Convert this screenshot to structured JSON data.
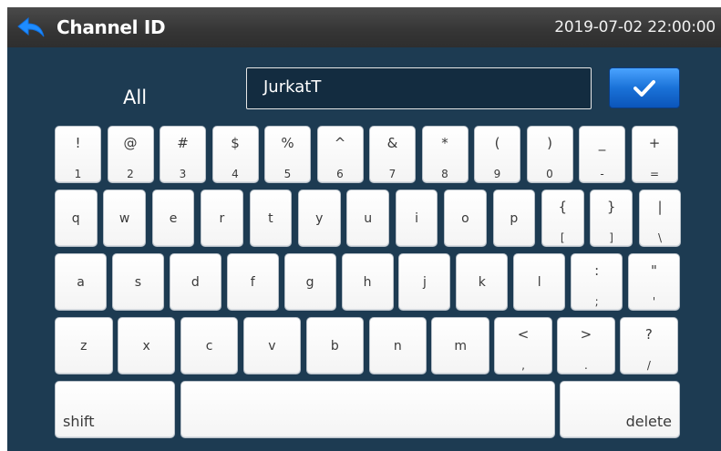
{
  "header": {
    "title": "Channel ID",
    "datetime": "2019-07-02  22:00:00",
    "back_icon": "back-arrow-icon"
  },
  "mode_label": "All",
  "input": {
    "value": "JurkatT"
  },
  "confirm_icon": "checkmark-icon",
  "colors": {
    "background": "#1d3b52",
    "header": "#3a3a3a",
    "accent": "#1a72d8",
    "key": "#ffffff"
  },
  "keyboard": {
    "row1": [
      {
        "upper": "!",
        "lower": "1"
      },
      {
        "upper": "@",
        "lower": "2"
      },
      {
        "upper": "#",
        "lower": "3"
      },
      {
        "upper": "$",
        "lower": "4"
      },
      {
        "upper": "%",
        "lower": "5"
      },
      {
        "upper": "^",
        "lower": "6"
      },
      {
        "upper": "&",
        "lower": "7"
      },
      {
        "upper": "*",
        "lower": "8"
      },
      {
        "upper": "(",
        "lower": "9"
      },
      {
        "upper": ")",
        "lower": "0"
      },
      {
        "upper": "_",
        "lower": "-"
      },
      {
        "upper": "+",
        "lower": "="
      }
    ],
    "row2": [
      {
        "label": "q"
      },
      {
        "label": "w"
      },
      {
        "label": "e"
      },
      {
        "label": "r"
      },
      {
        "label": "t"
      },
      {
        "label": "y"
      },
      {
        "label": "u"
      },
      {
        "label": "i"
      },
      {
        "label": "o"
      },
      {
        "label": "p"
      },
      {
        "upper": "{",
        "lower": "["
      },
      {
        "upper": "}",
        "lower": "]"
      },
      {
        "upper": "|",
        "lower": "\\"
      }
    ],
    "row3": [
      {
        "label": "a"
      },
      {
        "label": "s"
      },
      {
        "label": "d"
      },
      {
        "label": "f"
      },
      {
        "label": "g"
      },
      {
        "label": "h"
      },
      {
        "label": "j"
      },
      {
        "label": "k"
      },
      {
        "label": "l"
      },
      {
        "upper": ":",
        "lower": ";"
      },
      {
        "upper": "\"",
        "lower": "'"
      }
    ],
    "row4": [
      {
        "label": "z"
      },
      {
        "label": "x"
      },
      {
        "label": "c"
      },
      {
        "label": "v"
      },
      {
        "label": "b"
      },
      {
        "label": "n"
      },
      {
        "label": "m"
      },
      {
        "upper": "<",
        "lower": ","
      },
      {
        "upper": ">",
        "lower": "."
      },
      {
        "upper": "?",
        "lower": "/"
      }
    ],
    "shift_label": "shift",
    "delete_label": "delete"
  }
}
